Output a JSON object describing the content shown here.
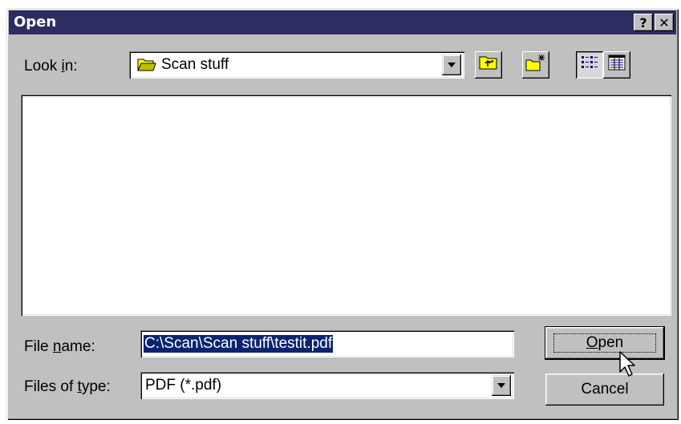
{
  "window": {
    "title": "Open",
    "help_icon": "?",
    "close_icon": "✕"
  },
  "look_in": {
    "label_prefix": "Look ",
    "label_mnemonic": "i",
    "label_suffix": "n:",
    "value": "Scan stuff",
    "folder_icon": "open-folder-icon"
  },
  "toolbar": {
    "up_folder_icon": "up-one-level-icon",
    "new_folder_icon": "create-new-folder-icon",
    "list_view_icon": "list-view-icon",
    "details_view_icon": "details-view-icon"
  },
  "file_name": {
    "label_prefix": "File ",
    "label_mnemonic": "n",
    "label_suffix": "ame:",
    "value": "C:\\Scan\\Scan stuff\\testit.pdf"
  },
  "files_of_type": {
    "label_prefix": "Files of ",
    "label_mnemonic": "t",
    "label_suffix": "ype:",
    "value": "PDF (*.pdf)"
  },
  "buttons": {
    "open_mnemonic": "O",
    "open_rest": "pen",
    "cancel": "Cancel"
  },
  "colors": {
    "titlebar": "#2d2d62",
    "face": "#c0c0c0",
    "selection": "#0a2470"
  }
}
